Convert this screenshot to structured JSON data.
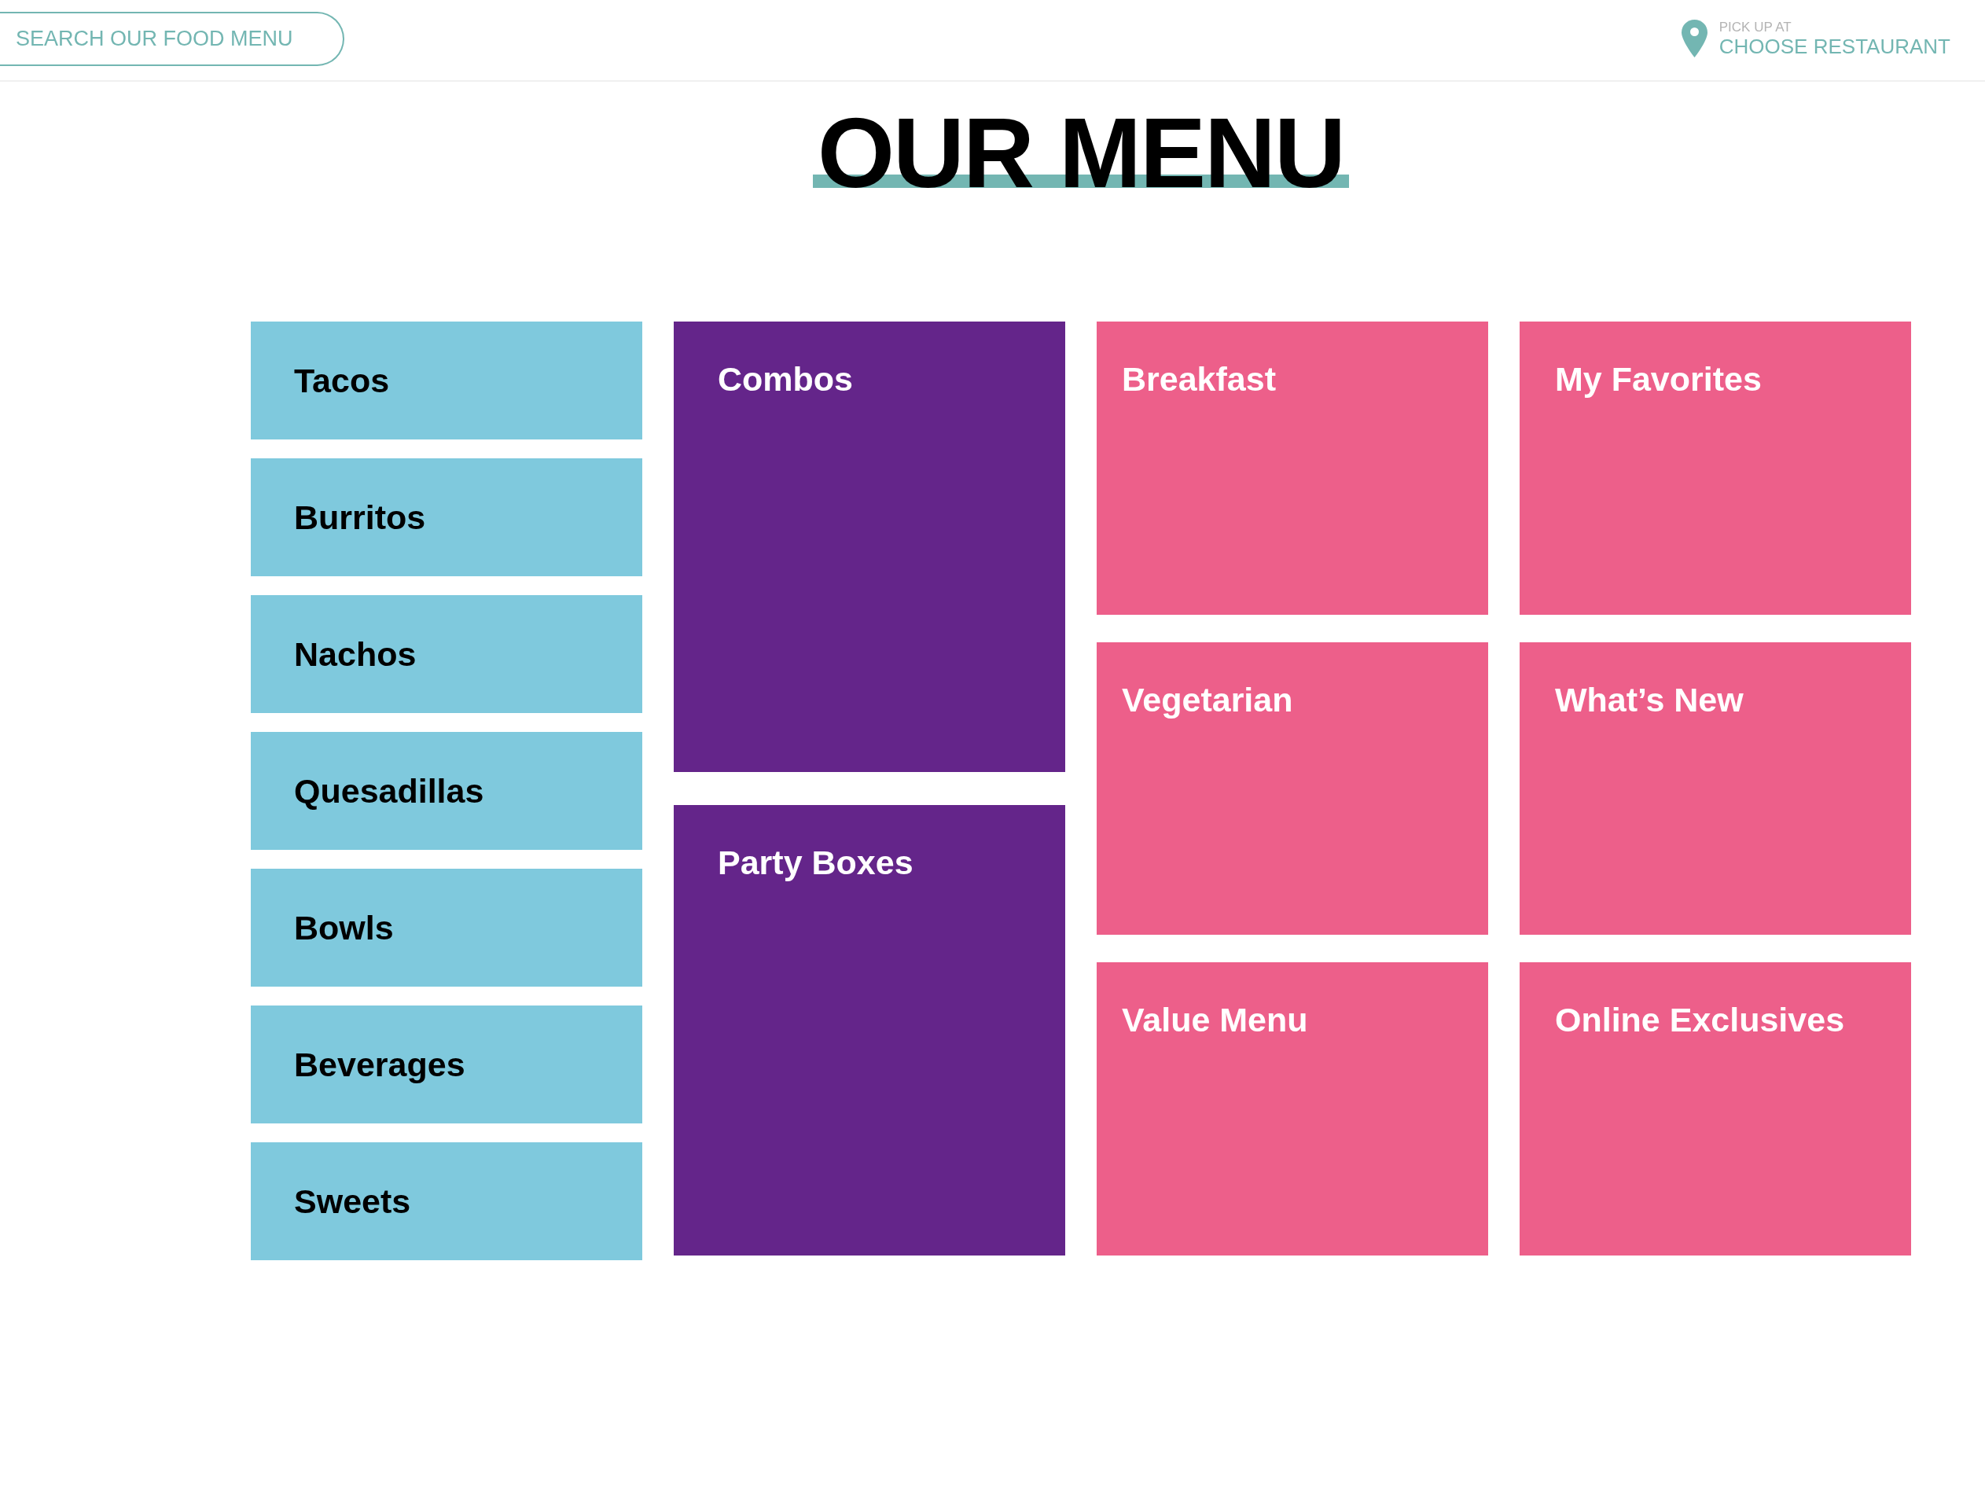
{
  "header": {
    "search": {
      "placeholder": "SEARCH OUR FOOD MENU"
    },
    "pickup": {
      "label": "PICK UP AT",
      "restaurant": "CHOOSE RESTAURANT"
    }
  },
  "title": "OUR MENU",
  "menu_columns": [
    {
      "kind": "list",
      "tiles": [
        {
          "label": "Tacos",
          "color": "#7fc9dd"
        },
        {
          "label": "Burritos",
          "color": "#7fc9dd"
        },
        {
          "label": "Nachos",
          "color": "#7fc9dd"
        },
        {
          "label": "Quesadillas",
          "color": "#7fc9dd"
        },
        {
          "label": "Bowls",
          "color": "#7fc9dd"
        },
        {
          "label": "Beverages",
          "color": "#7fc9dd"
        },
        {
          "label": "Sweets",
          "color": "#7fc9dd"
        }
      ]
    },
    {
      "kind": "feature",
      "tiles": [
        {
          "label": "Combos",
          "color": "#64258a"
        },
        {
          "label": "Party Boxes",
          "color": "#64258a"
        }
      ]
    },
    {
      "kind": "feature",
      "tiles": [
        {
          "label": "Breakfast",
          "color": "#ed5f8a"
        },
        {
          "label": "Vegetarian",
          "color": "#ed5f8a"
        },
        {
          "label": "Value Menu",
          "color": "#ed5f8a"
        }
      ]
    },
    {
      "kind": "feature",
      "tiles": [
        {
          "label": "My Favorites",
          "color": "#ed5f8a"
        },
        {
          "label": "What’s New",
          "color": "#ed5f8a"
        },
        {
          "label": "Online Exclusives",
          "color": "#ed5f8a"
        }
      ]
    }
  ]
}
